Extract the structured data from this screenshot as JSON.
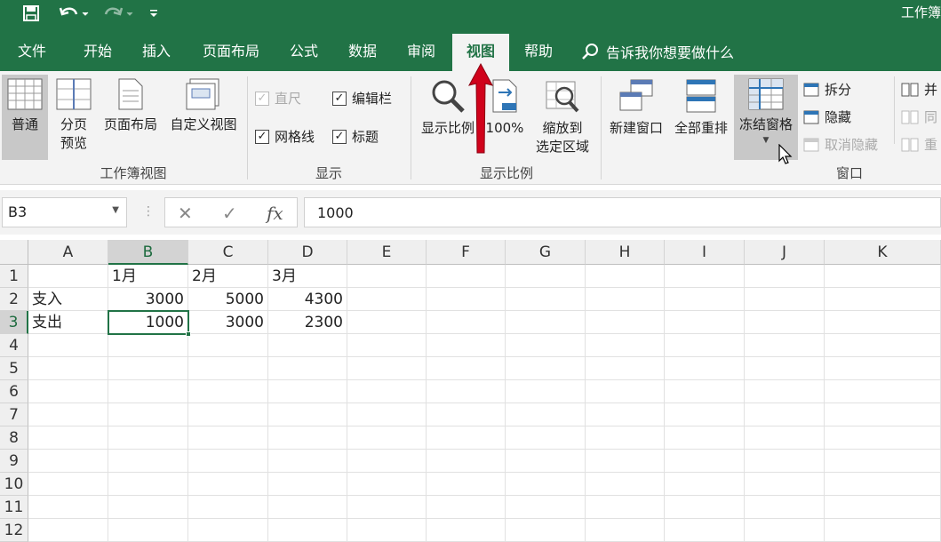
{
  "title_bar": {
    "title": "工作簿"
  },
  "tabs": [
    {
      "label": "文件"
    },
    {
      "label": "开始"
    },
    {
      "label": "插入"
    },
    {
      "label": "页面布局"
    },
    {
      "label": "公式"
    },
    {
      "label": "数据"
    },
    {
      "label": "审阅"
    },
    {
      "label": "视图",
      "active": true
    },
    {
      "label": "帮助"
    }
  ],
  "tell_me": "告诉我你想要做什么",
  "ribbon": {
    "workbook_views": {
      "label": "工作簿视图",
      "normal": "普通",
      "page_break_line1": "分页",
      "page_break_line2": "预览",
      "page_layout": "页面布局",
      "custom_views": "自定义视图"
    },
    "show": {
      "label": "显示",
      "ruler": "直尺",
      "formula_bar": "编辑栏",
      "gridlines": "网格线",
      "headings": "标题"
    },
    "zoom": {
      "label": "显示比例",
      "zoom": "显示比例",
      "zoom_100": "100%",
      "zoom_sel_line1": "缩放到",
      "zoom_sel_line2": "选定区域"
    },
    "window": {
      "label": "窗口",
      "new_window": "新建窗口",
      "arrange_all": "全部重排",
      "freeze_panes": "冻结窗格",
      "split": "拆分",
      "hide": "隐藏",
      "unhide": "取消隐藏",
      "side_by_side": "并",
      "sync_scroll": "同",
      "reset_pos": "重"
    }
  },
  "formula_bar": {
    "name_box": "B3",
    "formula": "1000"
  },
  "sheet": {
    "columns": [
      "A",
      "B",
      "C",
      "D",
      "E",
      "F",
      "G",
      "H",
      "I",
      "J",
      "K"
    ],
    "rows": [
      "1",
      "2",
      "3",
      "4",
      "5",
      "6",
      "7",
      "8",
      "9",
      "10",
      "11",
      "12"
    ],
    "cells": {
      "B1": "1月",
      "C1": "2月",
      "D1": "3月",
      "A2": "支入",
      "B2": "3000",
      "C2": "5000",
      "D2": "4300",
      "A3": "支出",
      "B3": "1000",
      "C3": "3000",
      "D3": "2300"
    },
    "active_cell": "B3"
  },
  "colors": {
    "accent": "#217346",
    "arrow": "#d0021b"
  },
  "icons": [
    "save-icon",
    "undo-icon",
    "redo-icon",
    "customize-qat-icon",
    "lightbulb-search-icon",
    "cursor-arrow-icon",
    "red-arrow-annotation"
  ]
}
